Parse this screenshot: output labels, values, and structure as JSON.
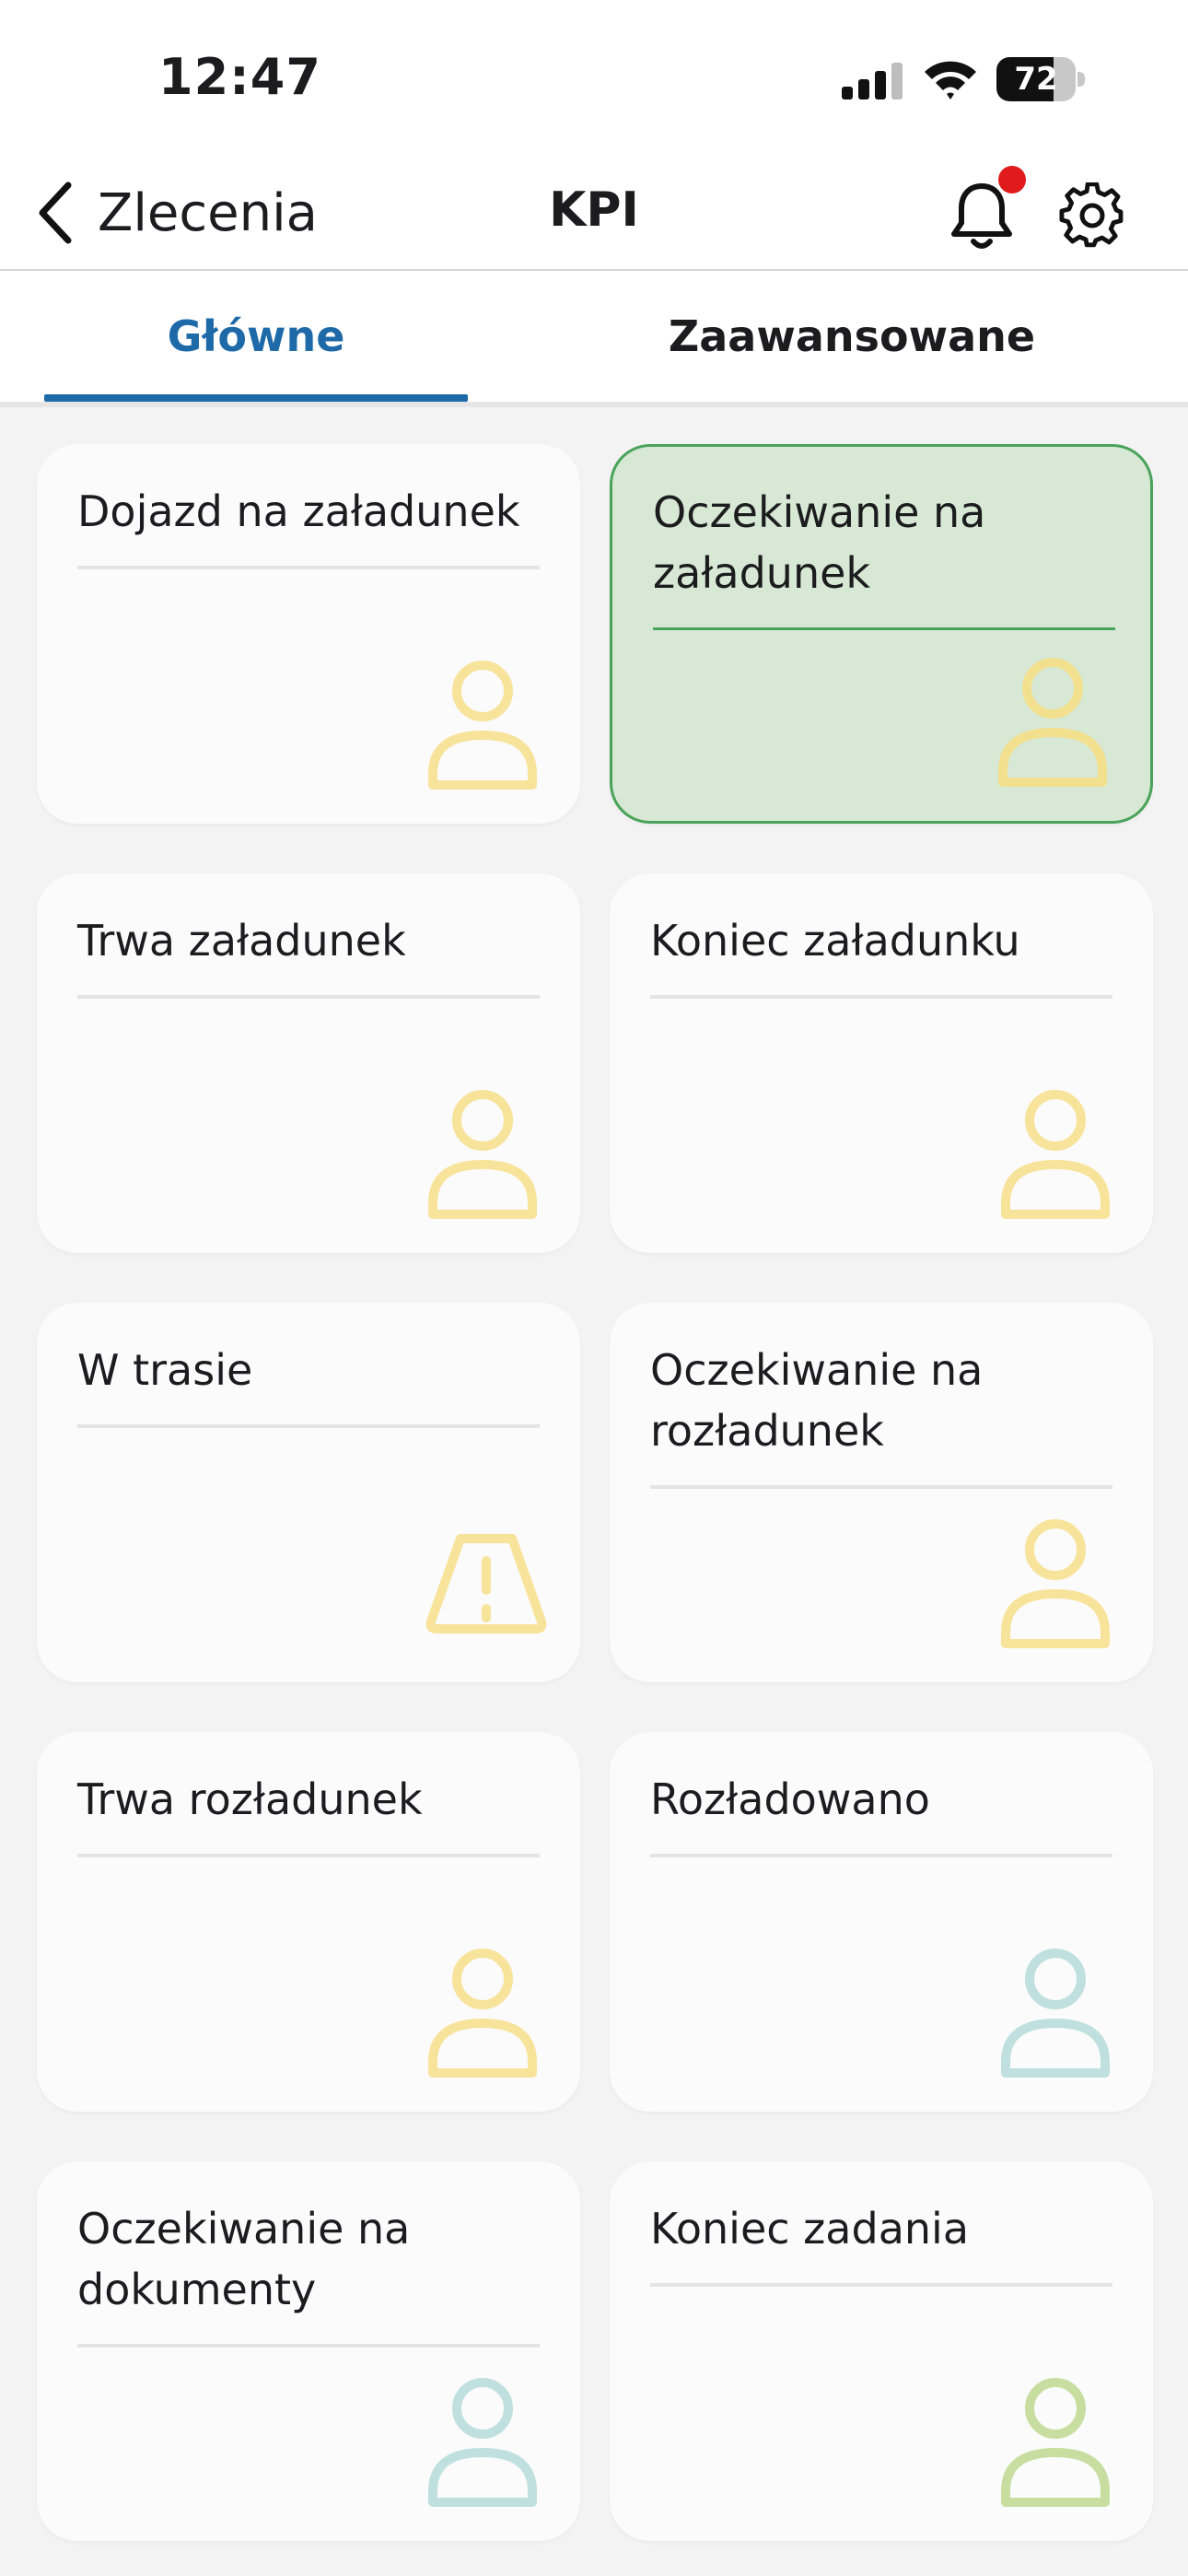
{
  "status_bar": {
    "time": "12:47",
    "battery": "72",
    "battery_level_pct": 72
  },
  "nav": {
    "back_label": "Zlecenia",
    "title": "KPI",
    "notification_dot_color": "#e11b1b"
  },
  "tabs": [
    {
      "label": "Główne",
      "active": true
    },
    {
      "label": "Zaawansowane",
      "active": false
    }
  ],
  "colors": {
    "accent": "#1e6aa8",
    "active_card_bg": "#d7e8d5",
    "active_card_border": "#4aa35a",
    "icon_yellow": "#f7e39a",
    "icon_teal": "#bfe0de",
    "icon_green": "#c7dea0"
  },
  "cards": [
    {
      "title": "Dojazd na załadunek",
      "icon": "person-icon",
      "icon_color": "#f7e39a",
      "active": false
    },
    {
      "title": "Oczekiwanie na załadunek",
      "icon": "person-icon",
      "icon_color": "#f2e08f",
      "active": true
    },
    {
      "title": "Trwa załadunek",
      "icon": "person-icon",
      "icon_color": "#f7e39a",
      "active": false
    },
    {
      "title": "Koniec załadunku",
      "icon": "person-icon",
      "icon_color": "#f7e39a",
      "active": false
    },
    {
      "title": "W trasie",
      "icon": "road-warning-icon",
      "icon_color": "#f7e39a",
      "active": false
    },
    {
      "title": "Oczekiwanie na rozładunek",
      "icon": "person-icon",
      "icon_color": "#f7e39a",
      "active": false
    },
    {
      "title": "Trwa rozładunek",
      "icon": "person-icon",
      "icon_color": "#f7e39a",
      "active": false
    },
    {
      "title": "Rozładowano",
      "icon": "person-icon",
      "icon_color": "#bfe0de",
      "active": false
    },
    {
      "title": "Oczekiwanie na dokumenty",
      "icon": "person-icon",
      "icon_color": "#bfe0de",
      "active": false
    },
    {
      "title": "Koniec zadania",
      "icon": "person-icon",
      "icon_color": "#c7dea0",
      "active": false
    }
  ]
}
